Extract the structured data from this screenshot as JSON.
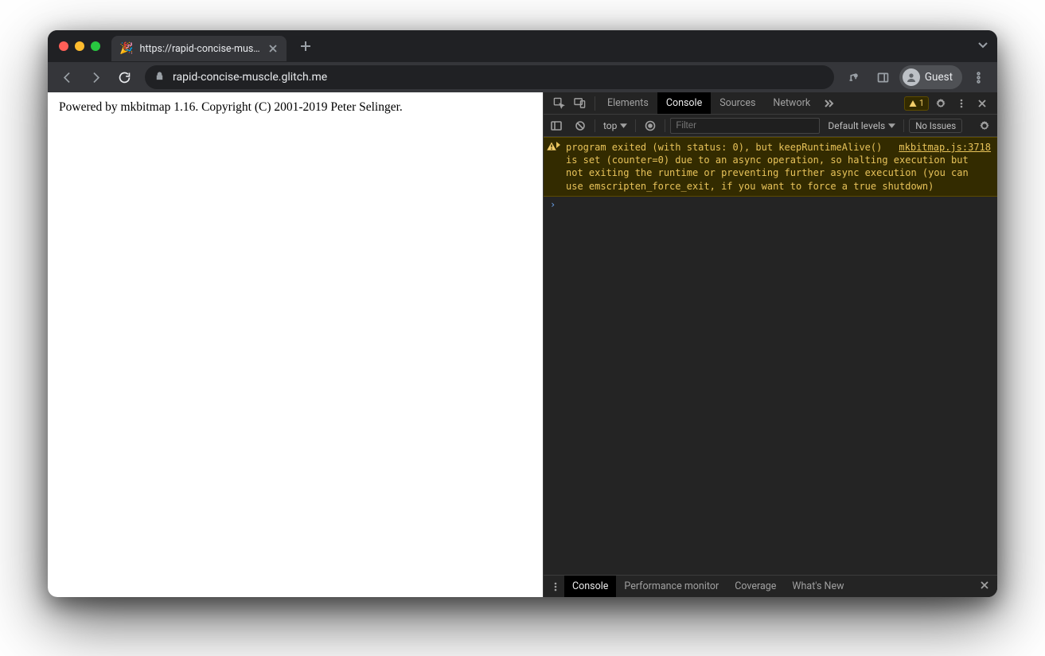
{
  "browser": {
    "tab_title": "https://rapid-concise-muscle.g",
    "favicon": "🎉",
    "url_display": "rapid-concise-muscle.glitch.me",
    "guest_label": "Guest"
  },
  "page": {
    "body_text": "Powered by mkbitmap 1.16. Copyright (C) 2001-2019 Peter Selinger."
  },
  "devtools": {
    "tabs": {
      "elements": "Elements",
      "console": "Console",
      "sources": "Sources",
      "network": "Network"
    },
    "warning_count": "1",
    "filter": {
      "context": "top",
      "placeholder": "Filter",
      "levels": "Default levels",
      "issues": "No Issues"
    },
    "console_warning": {
      "source_link": "mkbitmap.js:3718",
      "message": "program exited (with status: 0), but keepRuntimeAlive() is set (counter=0) due to an async operation, so halting execution but not exiting the runtime or preventing further async execution (you can use emscripten_force_exit, if you want to force a true shutdown)"
    },
    "drawer": {
      "console": "Console",
      "perf": "Performance monitor",
      "coverage": "Coverage",
      "whatsnew": "What's New"
    }
  }
}
